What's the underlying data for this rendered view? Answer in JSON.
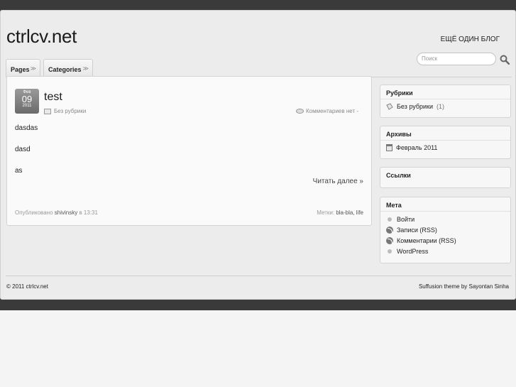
{
  "header": {
    "site_title": "ctrlcv.net",
    "tagline": "ЕЩЁ ОДИН БЛОГ"
  },
  "nav": {
    "tabs": [
      {
        "label": "Pages"
      },
      {
        "label": "Categories"
      }
    ],
    "search_placeholder": "Поиск"
  },
  "post": {
    "date_month": "Фев",
    "date_day": "09",
    "date_year": "2011",
    "title": "test",
    "category": "Без рубрики",
    "comments": "Комментариев нет -",
    "paragraphs": [
      "dasdas",
      "dasd",
      "as"
    ],
    "read_more": "Читать далее »",
    "published_prefix": "Опубликовано",
    "author": "shivinsky",
    "published_suffix": "в 13:31",
    "tags_prefix": "Метки:",
    "tags": "bla-bla, life"
  },
  "sidebar": {
    "categories": {
      "title": "Рубрики",
      "items": [
        {
          "label": "Без рубрики",
          "count": "(1)"
        }
      ]
    },
    "archives": {
      "title": "Архивы",
      "items": [
        {
          "label": "Февраль 2011"
        }
      ]
    },
    "links": {
      "title": "Ссылки"
    },
    "meta": {
      "title": "Мета",
      "items": [
        {
          "label": "Войти",
          "icon": "bullet"
        },
        {
          "label": "Записи (RSS)",
          "icon": "rss-icon"
        },
        {
          "label": "Комментарии (RSS)",
          "icon": "rss-icon"
        },
        {
          "label": "WordPress",
          "icon": "bullet"
        }
      ]
    }
  },
  "footer": {
    "copyright": "© 2011 ctrlcv.net",
    "credit": "Suffusion theme by Sayontan Sinha"
  }
}
